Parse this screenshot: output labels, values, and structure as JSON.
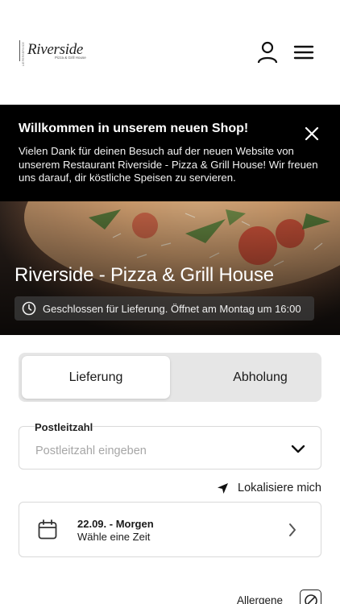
{
  "header": {
    "logo_name": "Riverside",
    "logo_sub": "Pizza & Grill House",
    "logo_side": "LIEFERSERVICE"
  },
  "banner": {
    "title": "Willkommen in unserem neuen Shop!",
    "text": "Vielen Dank für deinen Besuch auf der neuen Website von unserem Restaurant Riverside - Pizza & Grill House! Wir freuen uns darauf, dir köstliche Speisen zu servieren."
  },
  "hero": {
    "title": "Riverside - Pizza & Grill House",
    "status": "Geschlossen für Lieferung. Öffnet am Montag um 16:00"
  },
  "order_mode": {
    "options": [
      "Lieferung",
      "Abholung"
    ],
    "selected": "Lieferung"
  },
  "postal": {
    "label": "Postleitzahl",
    "placeholder": "Postleitzahl eingeben"
  },
  "locate": {
    "label": "Lokalisiere mich"
  },
  "date": {
    "line1": "22.09. - Morgen",
    "line2": "Wähle eine Zeit"
  },
  "allergens": {
    "label": "Allergene"
  },
  "colors": {
    "banner_bg": "#000000",
    "toggle_bg": "#e6e6e6",
    "border": "#d9d9d9"
  }
}
